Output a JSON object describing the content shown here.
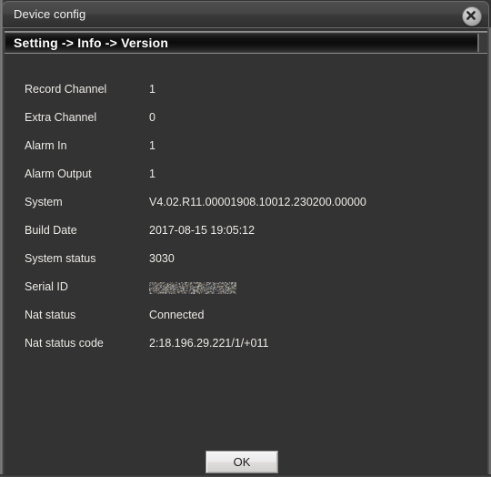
{
  "window": {
    "title": "Device config",
    "close_icon": "close-icon"
  },
  "header": {
    "breadcrumb": "Setting -> Info -> Version"
  },
  "info": {
    "rows": [
      {
        "label": "Record Channel",
        "value": "1"
      },
      {
        "label": "Extra Channel",
        "value": "0"
      },
      {
        "label": "Alarm In",
        "value": "1"
      },
      {
        "label": "Alarm Output",
        "value": "1"
      },
      {
        "label": "System",
        "value": "V4.02.R11.00001908.10012.230200.00000"
      },
      {
        "label": "Build Date",
        "value": "2017-08-15 19:05:12"
      },
      {
        "label": "System status",
        "value": "3030"
      },
      {
        "label": "Serial ID",
        "value": "",
        "redacted": true
      },
      {
        "label": "Nat status",
        "value": "Connected"
      },
      {
        "label": "Nat status code",
        "value": "2:18.196.29.221/1/+011"
      }
    ]
  },
  "footer": {
    "ok_label": "OK"
  },
  "colors": {
    "window_background": "#333333",
    "titlebar": "#464646",
    "header_bar": "#0b0b0b",
    "text": "#eceae6",
    "button_face": "#eceaea"
  }
}
